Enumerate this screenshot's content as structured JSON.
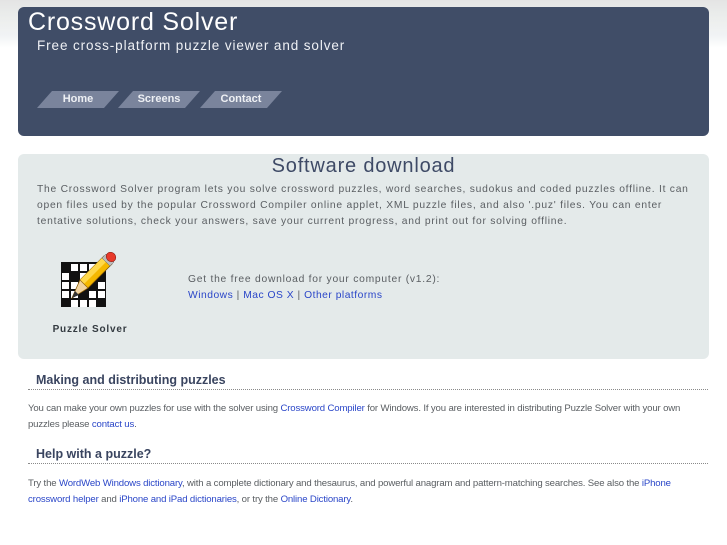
{
  "header": {
    "title": "Crossword Solver",
    "tagline": "Free cross-platform puzzle viewer and solver",
    "background_color": "#404d67",
    "nav": [
      {
        "label": "Home"
      },
      {
        "label": "Screens"
      },
      {
        "label": "Contact"
      }
    ]
  },
  "download": {
    "title": "Software download",
    "description": "The Crossword Solver program lets you solve crossword puzzles, word searches, sudokus and coded puzzles offline. It can open files used by the popular Crossword Compiler online applet, XML puzzle files, and also '.puz' files. You can enter tentative solutions, check your answers, save your current progress, and print out for solving offline.",
    "app_icon": "crossword-grid-pencil-icon",
    "app_label": "Puzzle Solver",
    "get_text": "Get the free download for your computer (v1.2):",
    "links": [
      {
        "label": "Windows"
      },
      {
        "label": "Mac OS X"
      },
      {
        "label": "Other platforms"
      }
    ],
    "separator": "|"
  },
  "sections": {
    "making": {
      "heading": "Making and distributing puzzles",
      "text_1": "You can make your own puzzles for use with the solver using ",
      "link_1": "Crossword Compiler",
      "text_2": " for Windows. If you are interested in distributing Puzzle Solver with your own puzzles please ",
      "link_2": "contact us",
      "text_3": "."
    },
    "help": {
      "heading": "Help with a puzzle?",
      "text_1": "Try the ",
      "link_1": "WordWeb Windows dictionary",
      "text_2": ", with a complete dictionary and thesaurus, and powerful anagram and pattern-matching searches. See also the ",
      "link_2": "iPhone crossword helper",
      "text_3": " and ",
      "link_3": "iPhone and iPad dictionaries",
      "text_4": ", or try the ",
      "link_4": "Online Dictionary",
      "text_5": "."
    }
  },
  "colors": {
    "link": "#2a46c8",
    "heading": "#3a4560",
    "download_box": "#e4eaea",
    "nav_tab": "#7a849c"
  }
}
